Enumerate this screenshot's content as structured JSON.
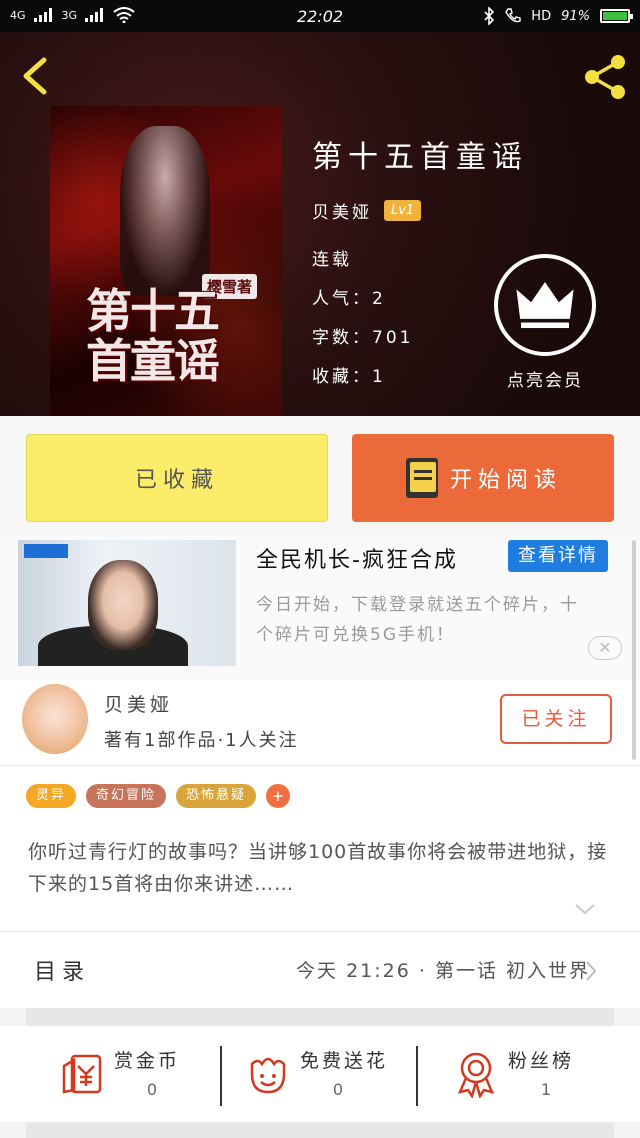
{
  "status_bar": {
    "network_1": "4G",
    "network_2": "3G",
    "time": "22:02",
    "hd_label": "HD",
    "battery_text": "91%",
    "battery_level": 0.91
  },
  "book": {
    "title": "第十五首童谣",
    "author": "贝美娅",
    "level": "Lv1",
    "status": "连载",
    "popularity": "人气：2",
    "word_count": "字数：701",
    "collections": "收藏：1",
    "cover_title": "第十五首童谣",
    "cover_author": "樱雪著"
  },
  "vip": {
    "label": "点亮会员"
  },
  "actions": {
    "collect_label": "已收藏",
    "read_label": "开始阅读"
  },
  "ad": {
    "title": "全民机长-疯狂合成",
    "detail_label": "查看详情",
    "description": "今日开始，下载登录就送五个碎片，十个碎片可兑换5G手机！",
    "close_symbol": "✕"
  },
  "author": {
    "name": "贝美娅",
    "stats": "著有1部作品·1人关注",
    "follow_label": "已关注"
  },
  "tags": [
    {
      "label": "灵异",
      "color": "#f5a623"
    },
    {
      "label": "奇幻冒险",
      "color": "#c8735a"
    },
    {
      "label": "恐怖悬疑",
      "color": "#d9a53a"
    },
    {
      "label": "+",
      "color": "#f07040"
    }
  ],
  "description": "你听过青行灯的故事吗？当讲够100首故事你将会被带进地狱，接下来的15首将由你来讲述……",
  "catalog": {
    "label": "目录",
    "latest": "今天 21:26 · 第一话 初入世界"
  },
  "rewards": [
    {
      "label": "赏金币",
      "count": "0",
      "icon": "red-envelope-icon"
    },
    {
      "label": "免费送花",
      "count": "0",
      "icon": "flower-icon"
    },
    {
      "label": "粉丝榜",
      "count": "1",
      "icon": "medal-icon"
    }
  ],
  "colors": {
    "accent_orange": "#ec6a3a",
    "collect_yellow": "#fbed6a",
    "ad_blue": "#1f7de0",
    "follow_red": "#e35a3c",
    "header_icon_yellow": "#f2e043"
  }
}
